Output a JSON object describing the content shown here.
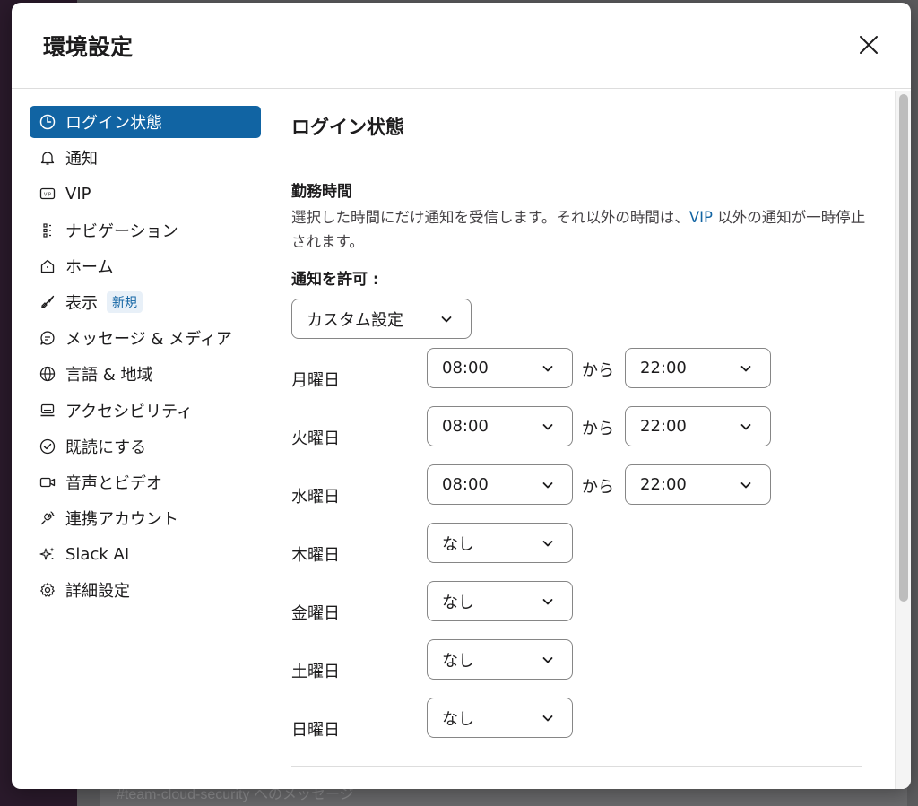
{
  "backdrop": {
    "message_placeholder": "#team-cloud-security へのメッセージ"
  },
  "modal": {
    "title": "環境設定",
    "close_icon": "close-icon"
  },
  "sidebar": {
    "items": [
      {
        "label": "ログイン状態",
        "icon": "clock-icon",
        "active": true
      },
      {
        "label": "通知",
        "icon": "bell-icon"
      },
      {
        "label": "VIP",
        "icon": "vip-icon"
      },
      {
        "label": "ナビゲーション",
        "icon": "navigation-icon"
      },
      {
        "label": "ホーム",
        "icon": "home-icon"
      },
      {
        "label": "表示",
        "icon": "brush-icon",
        "badge": "新規"
      },
      {
        "label": "メッセージ & メディア",
        "icon": "message-icon"
      },
      {
        "label": "言語 & 地域",
        "icon": "globe-icon"
      },
      {
        "label": "アクセシビリティ",
        "icon": "keyboard-icon"
      },
      {
        "label": "既読にする",
        "icon": "check-circle-icon"
      },
      {
        "label": "音声とビデオ",
        "icon": "video-icon"
      },
      {
        "label": "連携アカウント",
        "icon": "plug-icon"
      },
      {
        "label": "Slack AI",
        "icon": "sparkle-icon"
      },
      {
        "label": "詳細設定",
        "icon": "gear-icon"
      }
    ]
  },
  "content": {
    "section_title": "ログイン状態",
    "work_hours_heading": "勤務時間",
    "description_before": "選択した時間にだけ通知を受信します。それ以外の時間は、",
    "description_link": "VIP",
    "description_after": " 以外の通知が一時停止されます。",
    "allow_label": "通知を許可 :",
    "mode_value": "カスタム設定",
    "from_label": "から",
    "days": [
      {
        "day": "月曜日",
        "start": "08:00",
        "end": "22:00"
      },
      {
        "day": "火曜日",
        "start": "08:00",
        "end": "22:00"
      },
      {
        "day": "水曜日",
        "start": "08:00",
        "end": "22:00"
      },
      {
        "day": "木曜日",
        "value": "なし"
      },
      {
        "day": "金曜日",
        "value": "なし"
      },
      {
        "day": "土曜日",
        "value": "なし"
      },
      {
        "day": "日曜日",
        "value": "なし"
      }
    ]
  },
  "colors": {
    "accent": "#1164a3",
    "link": "#1264a3",
    "text": "#1d1c1d"
  }
}
